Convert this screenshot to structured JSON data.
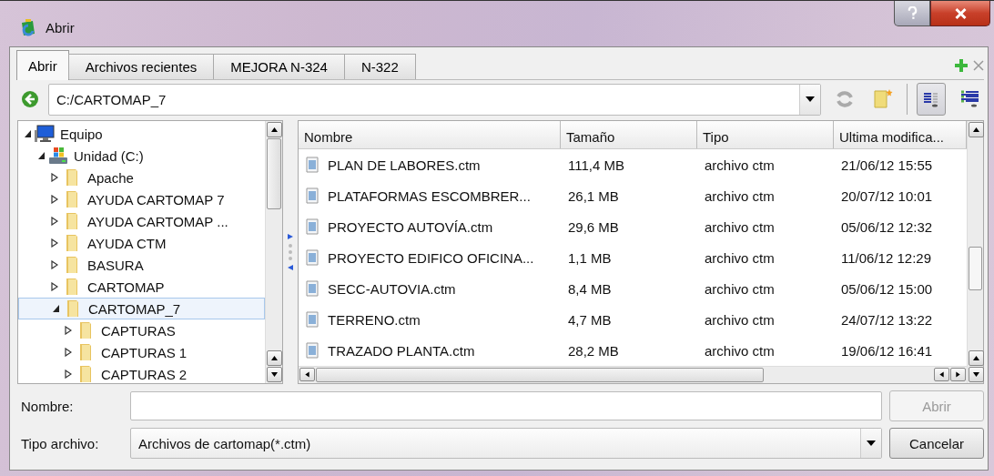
{
  "window": {
    "title": "Abrir"
  },
  "tabs": [
    {
      "label": "Abrir",
      "selected": true
    },
    {
      "label": "Archivos recientes",
      "selected": false
    },
    {
      "label": "MEJORA N-324",
      "selected": false
    },
    {
      "label": "N-322",
      "selected": false
    }
  ],
  "path": {
    "value": "C:/CARTOMAP_7"
  },
  "tree": [
    {
      "label": "Equipo",
      "kind": "computer",
      "expanded": true,
      "selected": false,
      "children": [
        {
          "label": "Unidad (C:)",
          "kind": "drive",
          "expanded": true,
          "selected": false,
          "children": [
            {
              "label": "Apache",
              "kind": "folder",
              "expanded": false,
              "selected": false
            },
            {
              "label": "AYUDA CARTOMAP 7",
              "kind": "folder",
              "expanded": false,
              "selected": false
            },
            {
              "label": "AYUDA CARTOMAP ...",
              "kind": "folder",
              "expanded": false,
              "selected": false
            },
            {
              "label": "AYUDA CTM",
              "kind": "folder",
              "expanded": false,
              "selected": false
            },
            {
              "label": "BASURA",
              "kind": "folder",
              "expanded": false,
              "selected": false
            },
            {
              "label": "CARTOMAP",
              "kind": "folder",
              "expanded": false,
              "selected": false
            },
            {
              "label": "CARTOMAP_7",
              "kind": "folder",
              "expanded": true,
              "selected": true,
              "children": [
                {
                  "label": "CAPTURAS",
                  "kind": "folder",
                  "expanded": false,
                  "selected": false
                },
                {
                  "label": "CAPTURAS 1",
                  "kind": "folder",
                  "expanded": false,
                  "selected": false
                },
                {
                  "label": "CAPTURAS 2",
                  "kind": "folder",
                  "expanded": false,
                  "selected": false
                }
              ]
            }
          ]
        }
      ]
    }
  ],
  "files": {
    "columns": [
      "Nombre",
      "Tamaño",
      "Tipo",
      "Ultima modifica..."
    ],
    "rows": [
      {
        "name": "PLAN DE LABORES.ctm",
        "size": "111,4 MB",
        "type": "archivo ctm",
        "modified": "21/06/12 15:55"
      },
      {
        "name": "PLATAFORMAS ESCOMBRER...",
        "size": "26,1 MB",
        "type": "archivo ctm",
        "modified": "20/07/12 10:01"
      },
      {
        "name": "PROYECTO AUTOVÍA.ctm",
        "size": "29,6 MB",
        "type": "archivo ctm",
        "modified": "05/06/12 12:32"
      },
      {
        "name": "PROYECTO EDIFICO OFICINA...",
        "size": "1,1 MB",
        "type": "archivo ctm",
        "modified": "11/06/12 12:29"
      },
      {
        "name": "SECC-AUTOVIA.ctm",
        "size": "8,4 MB",
        "type": "archivo ctm",
        "modified": "05/06/12 15:00"
      },
      {
        "name": "TERRENO.ctm",
        "size": "4,7 MB",
        "type": "archivo ctm",
        "modified": "24/07/12 13:22"
      },
      {
        "name": "TRAZADO PLANTA.ctm",
        "size": "28,2 MB",
        "type": "archivo ctm",
        "modified": "19/06/12 16:41"
      }
    ]
  },
  "name_field": {
    "label": "Nombre:"
  },
  "open_button": {
    "label": "Abrir",
    "disabled": true
  },
  "type_field": {
    "label": "Tipo archivo:",
    "value": "Archivos de cartomap(*.ctm)"
  },
  "cancel_button": {
    "label": "Cancelar",
    "disabled": false
  }
}
